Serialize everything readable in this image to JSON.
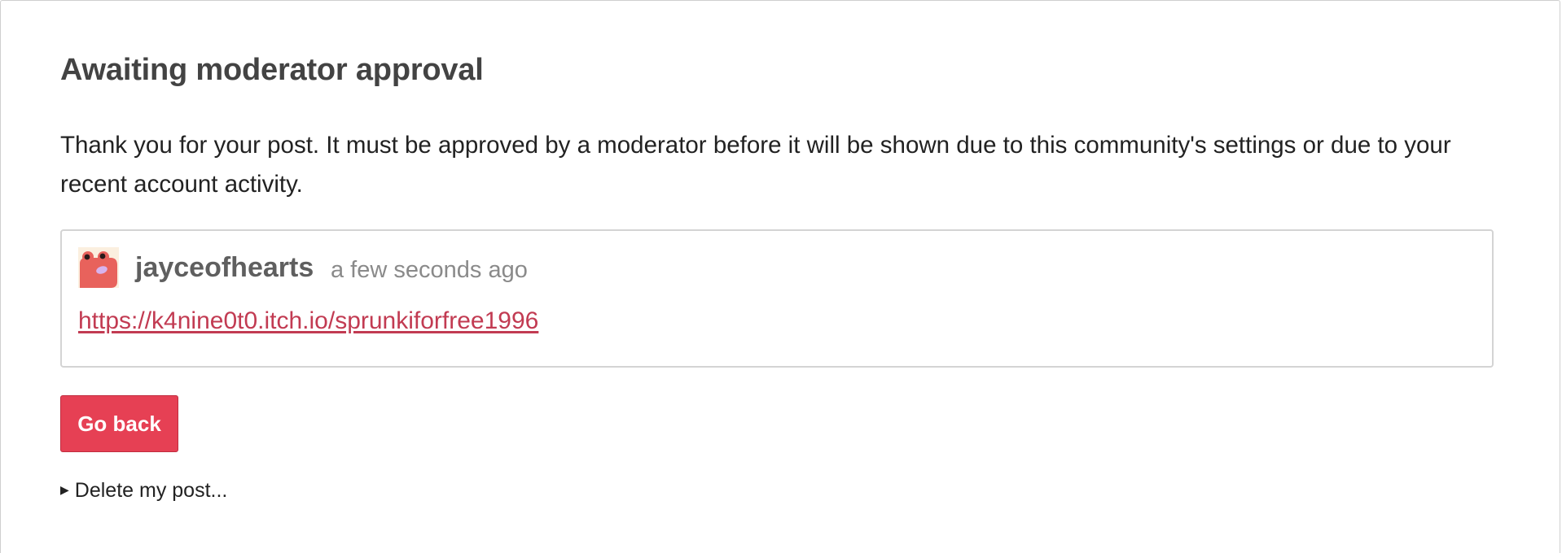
{
  "page": {
    "title": "Awaiting moderator approval",
    "notice": "Thank you for your post. It must be approved by a moderator before it will be shown due to this community's settings or due to your recent account activity."
  },
  "post": {
    "author": "jayceofhearts",
    "timestamp": "a few seconds ago",
    "link_text": "https://k4nine0t0.itch.io/sprunkiforfree1996",
    "avatar_icon": "frog-avatar-icon"
  },
  "actions": {
    "go_back_label": "Go back",
    "delete_label": "Delete my post...",
    "delete_marker_icon": "triangle-right-icon"
  },
  "colors": {
    "accent": "#e64054",
    "link": "#c23b52"
  }
}
